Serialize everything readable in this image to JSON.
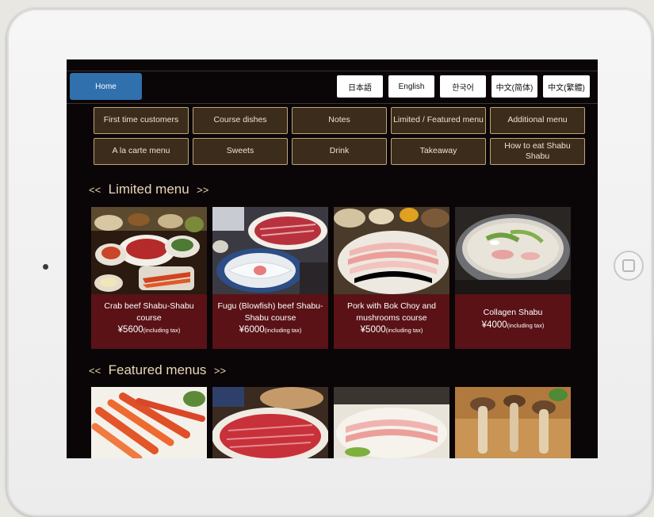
{
  "header": {
    "home_label": "Home",
    "languages": [
      "日本語",
      "English",
      "한국어",
      "中文(简体)",
      "中文(繁體)"
    ]
  },
  "nav": {
    "items": [
      "First time customers",
      "Course dishes",
      "Notes",
      "Limited / Featured menu",
      "Additional menu",
      "A la carte menu",
      "Sweets",
      "Drink",
      "Takeaway",
      "How to eat Shabu Shabu"
    ]
  },
  "limited": {
    "prefix": "<<",
    "title": "Limited menu",
    "suffix": ">>",
    "cards": [
      {
        "name": "Crab beef Shabu-Shabu course",
        "price": "¥5600",
        "tax": "(including tax)"
      },
      {
        "name": "Fugu (Blowfish) beef Shabu-Shabu course",
        "price": "¥6000",
        "tax": "(including tax)"
      },
      {
        "name": "Pork with Bok Choy and mushrooms course",
        "price": "¥5000",
        "tax": "(including tax)"
      },
      {
        "name": "Collagen Shabu",
        "price": "¥4000",
        "tax": "(including tax)"
      }
    ]
  },
  "featured": {
    "prefix": "<<",
    "title": "Featured menus",
    "suffix": ">>"
  },
  "colors": {
    "screen_bg": "#0a0506",
    "home_tab": "#2f70ad",
    "nav_button": "#3c2c1c",
    "nav_border": "#bfa37a",
    "card_caption": "#5a1216",
    "section_title": "#e9d7b5"
  }
}
